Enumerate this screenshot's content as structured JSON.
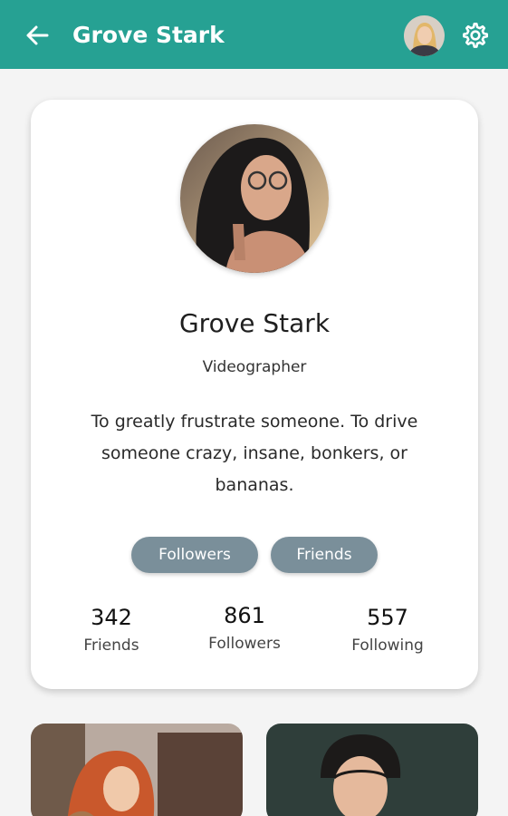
{
  "appbar": {
    "title": "Grove Stark",
    "back_icon": "arrow-left-icon",
    "avatar_icon": "user-avatar",
    "settings_icon": "gear-icon",
    "color": "#26a193"
  },
  "profile": {
    "name": "Grove Stark",
    "role": "Videographer",
    "bio": "To greatly frustrate someone. To drive someone crazy, insane, bonkers, or bananas."
  },
  "buttons": {
    "followers": "Followers",
    "friends": "Friends",
    "color": "#7a8f9a"
  },
  "stats": [
    {
      "value": "342",
      "label": "Friends"
    },
    {
      "value": "861",
      "label": "Followers"
    },
    {
      "value": "557",
      "label": "Following"
    }
  ],
  "gallery": {
    "items": [
      "photo-woman-red-hair",
      "photo-man-portrait"
    ]
  }
}
